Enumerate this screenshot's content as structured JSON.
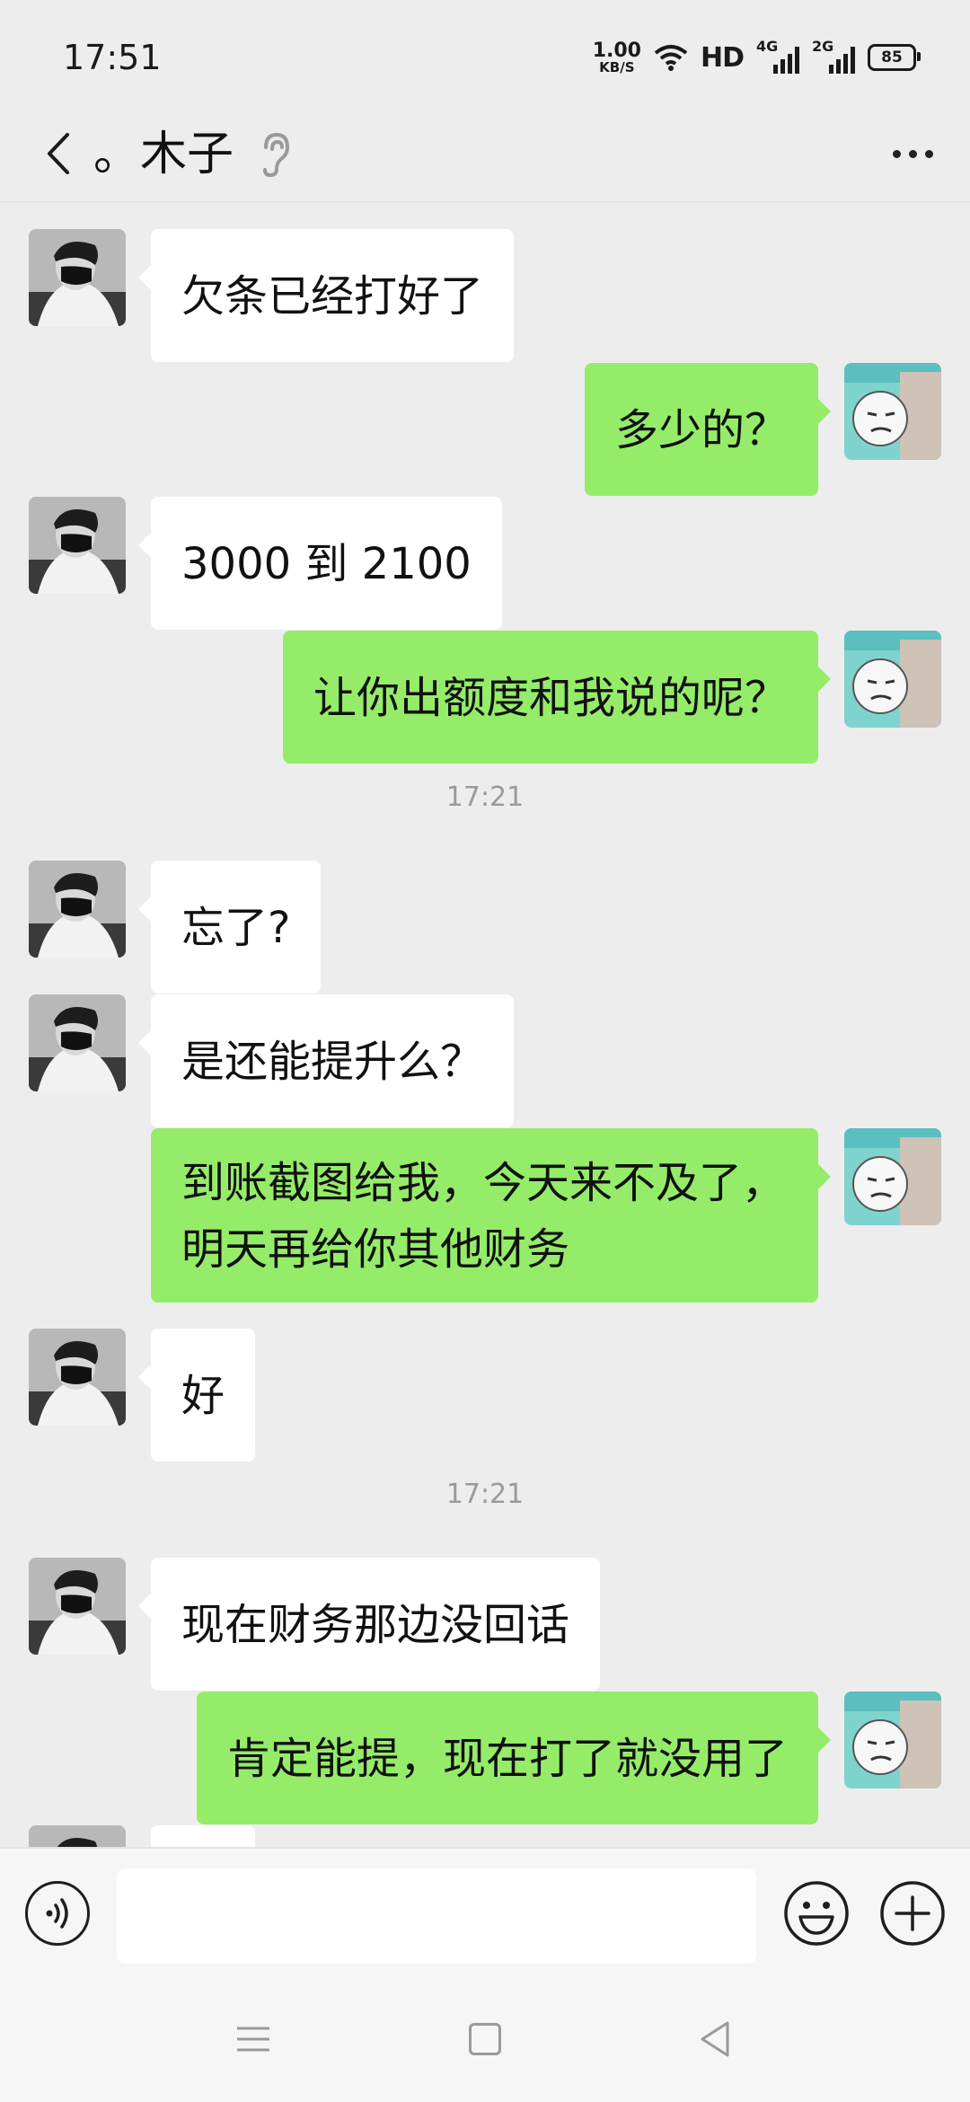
{
  "status_bar": {
    "time": "17:51",
    "speed_value": "1.00",
    "speed_unit": "KB/S",
    "hd": "HD",
    "net1": "4G",
    "net2": "2G",
    "battery": "85"
  },
  "header": {
    "title": "。木子",
    "icons": {
      "back": "chevron-left-icon",
      "ear": "ear-icon",
      "more": "more-dots-icon"
    }
  },
  "messages": [
    {
      "side": "in",
      "text": "欠条已经打好了"
    },
    {
      "side": "out",
      "text": "多少的？"
    },
    {
      "side": "in",
      "text": "3000 到 2100"
    },
    {
      "side": "out",
      "text": "让你出额度和我说的呢？"
    },
    {
      "type": "time",
      "text": "17:21"
    },
    {
      "side": "in",
      "text": "忘了?"
    },
    {
      "side": "in",
      "text": "是还能提升么？"
    },
    {
      "side": "out",
      "text": "到账截图给我，今天来不及了，明天再给你其他财务"
    },
    {
      "side": "in",
      "text": "好"
    },
    {
      "type": "time",
      "text": "17:21"
    },
    {
      "side": "in",
      "text": "现在财务那边没回话"
    },
    {
      "side": "out",
      "text": "肯定能提，现在打了就没用了"
    }
  ],
  "input_bar": {
    "text_value": "",
    "icons": {
      "voice": "voice-icon",
      "emoji": "emoji-icon",
      "plus": "plus-icon"
    }
  },
  "nav_bar": {
    "icons": {
      "menu": "menu-icon",
      "home": "home-square-icon",
      "back": "back-triangle-icon"
    }
  },
  "colors": {
    "background": "#ededed",
    "outgoing_bubble": "#95ec69",
    "incoming_bubble": "#ffffff",
    "timestamp": "#9a9a9a"
  }
}
